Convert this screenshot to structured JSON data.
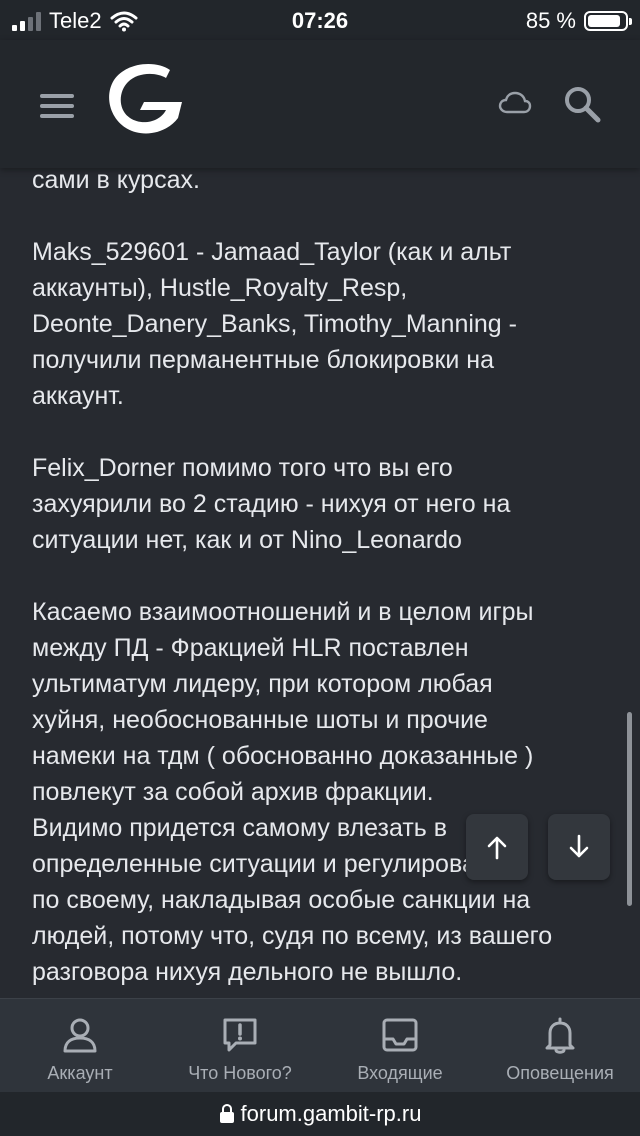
{
  "status_bar": {
    "carrier": "Tele2",
    "time": "07:26",
    "battery_text": "85 %",
    "icons": [
      "signal-icon",
      "wifi-icon",
      "battery-icon"
    ]
  },
  "header": {
    "icons": [
      "menu-icon",
      "gambit-logo",
      "cloud-icon",
      "search-icon"
    ]
  },
  "post": {
    "paragraphs": [
      "сами в курсах.",
      "Maks_529601 - Jamaad_Taylor (как и альт\nаккаунты), Hustle_Royalty_Resp,\nDeonte_Danery_Banks, Timothy_Manning -\nполучили перманентные блокировки на\nаккаунт.",
      "Felix_Dorner помимо того что вы его\nзахуярили во 2 стадию - нихуя от него на\nситуации нет, как и от Nino_Leonardo",
      "Касаемо взаимоотношений и в целом игры\nмежду ПД - Фракцией HLR поставлен\nультиматум лидеру, при котором любая\nхуйня, необоснованные шоты и прочие\nнамеки на тдм ( обоснованно доказанные )\nповлекут за собой архив фракции.",
      "Видимо придется самому влезать в\nопределенные ситуации и регулировать\nпо своему, накладывая особые санкции на\nлюдей, потому что, судя по всему, из вашего\nразговора нихуя дельного не вышло."
    ]
  },
  "scroll_buttons": {
    "up_icon": "arrow-up-icon",
    "down_icon": "arrow-down-icon"
  },
  "bottom_nav": {
    "items": [
      {
        "label": "Аккаунт",
        "icon": "user-icon"
      },
      {
        "label": "Что Нового?",
        "icon": "alert-message-icon"
      },
      {
        "label": "Входящие",
        "icon": "inbox-icon"
      },
      {
        "label": "Оповещения",
        "icon": "bell-icon"
      }
    ]
  },
  "url_bar": {
    "url": "forum.gambit-rp.ru",
    "icon": "lock-icon"
  },
  "colors": {
    "background": "#272a30",
    "header": "#23272c",
    "nav": "#2f343b",
    "text": "#e6e8ec",
    "icon": "#9aa0a8"
  }
}
